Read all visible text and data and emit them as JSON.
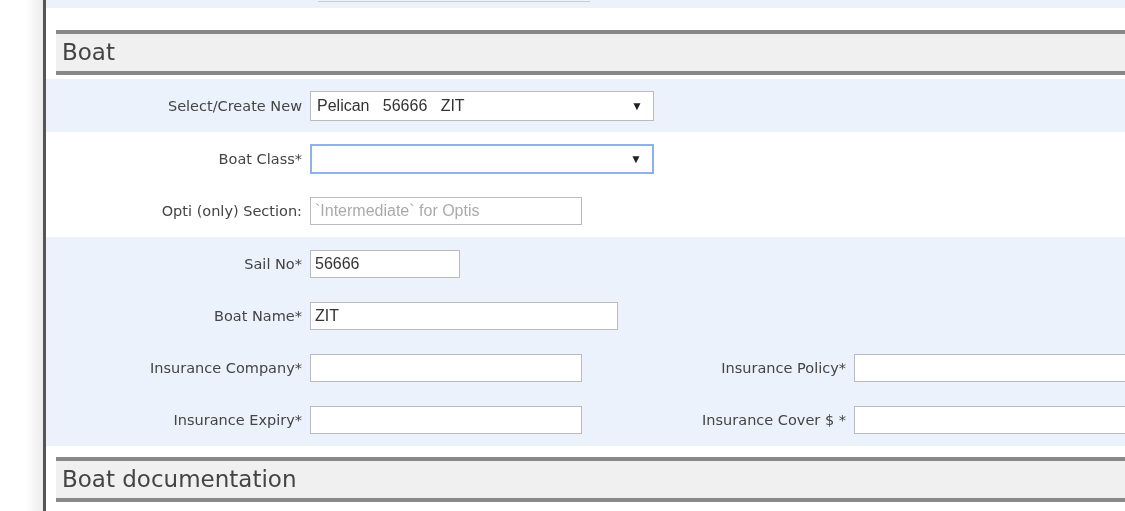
{
  "sections": [
    {
      "title": "Boat",
      "groups": [
        {
          "shaded": true,
          "rows": [
            {
              "fields": [
                {
                  "label": "Select/Create New",
                  "kind": "select",
                  "value": "Pelican   56666   ZIT",
                  "caret": "▼",
                  "focused": false
                }
              ]
            }
          ]
        },
        {
          "shaded": false,
          "rows": [
            {
              "fields": [
                {
                  "label": "Boat Class*",
                  "kind": "select",
                  "caret": "▼",
                  "focused": true
                }
              ]
            },
            {
              "fields": [
                {
                  "label": "Opti (only) Section:",
                  "kind": "input",
                  "placeholder": "`Intermediate` for Optis",
                  "focused": false
                }
              ]
            }
          ]
        },
        {
          "shaded": true,
          "rows": [
            {
              "fields": [
                {
                  "label": "Sail No*",
                  "kind": "input",
                  "value": "56666",
                  "focused": false
                }
              ]
            },
            {
              "fields": [
                {
                  "label": "Boat Name*",
                  "kind": "input",
                  "value": "ZIT",
                  "focused": false
                }
              ]
            },
            {
              "fields": [
                {
                  "label": "Insurance Company*",
                  "kind": "input",
                  "focused": false
                },
                {
                  "label": "Insurance Policy*",
                  "kind": "input",
                  "focused": false
                }
              ]
            },
            {
              "fields": [
                {
                  "label": "Insurance Expiry*",
                  "kind": "input",
                  "focused": false
                },
                {
                  "label": "Insurance Cover $ *",
                  "kind": "input",
                  "focused": false
                }
              ]
            }
          ]
        }
      ]
    },
    {
      "title": "Boat documentation"
    }
  ]
}
